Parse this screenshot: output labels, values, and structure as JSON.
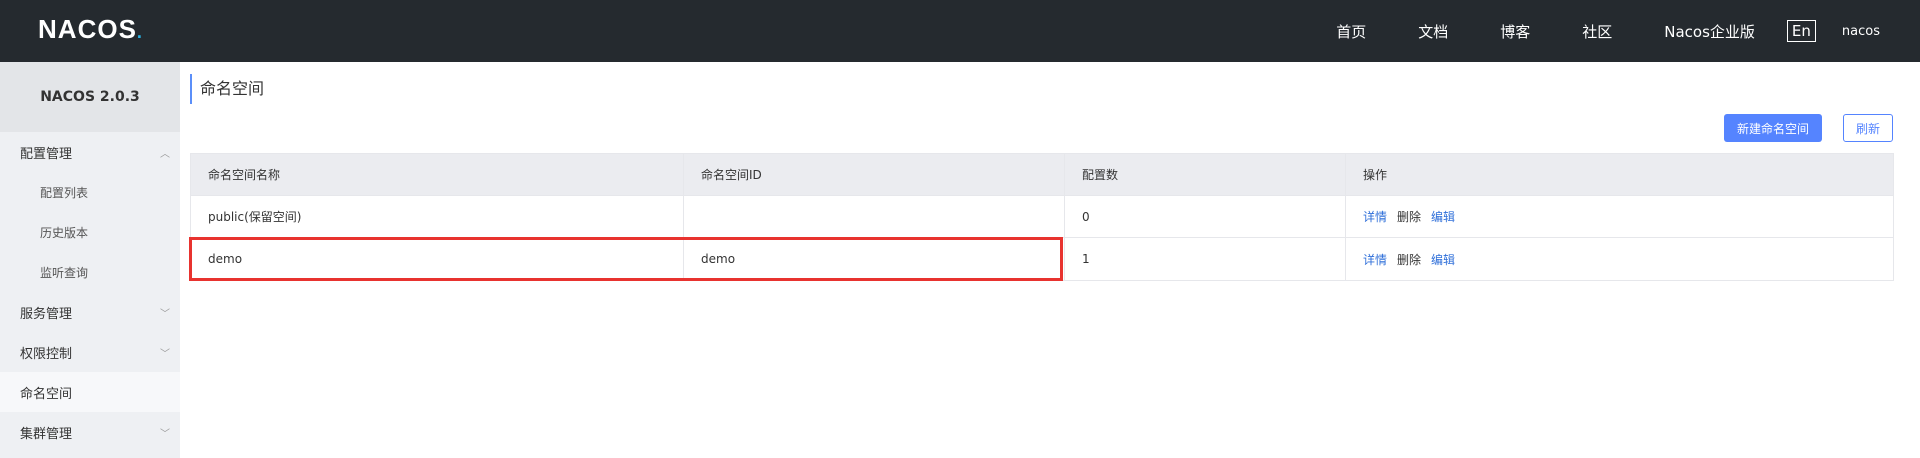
{
  "header": {
    "logo_text_1": "NA",
    "logo_text_2": "COS",
    "logo_dot": ".",
    "nav": [
      {
        "label": "首页"
      },
      {
        "label": "文档"
      },
      {
        "label": "博客"
      },
      {
        "label": "社区"
      },
      {
        "label": "Nacos企业版"
      }
    ],
    "lang_label": "En",
    "user_label": "nacos"
  },
  "sidebar": {
    "version": "NACOS 2.0.3",
    "groups": [
      {
        "label": "配置管理",
        "expanded": true,
        "items": [
          "配置列表",
          "历史版本",
          "监听查询"
        ]
      },
      {
        "label": "服务管理",
        "expanded": false
      },
      {
        "label": "权限控制",
        "expanded": false
      },
      {
        "label": "命名空间",
        "active": true
      },
      {
        "label": "集群管理",
        "expanded": false
      }
    ]
  },
  "main": {
    "title": "命名空间",
    "buttons": {
      "create": "新建命名空间",
      "refresh": "刷新"
    },
    "table": {
      "headers": [
        "命名空间名称",
        "命名空间ID",
        "配置数",
        "操作"
      ],
      "rows": [
        {
          "name": "public(保留空间)",
          "id": "",
          "count": "0",
          "actions": [
            "详情",
            "删除",
            "编辑"
          ]
        },
        {
          "name": "demo",
          "id": "demo",
          "count": "1",
          "actions": [
            "详情",
            "删除",
            "编辑"
          ]
        }
      ]
    }
  },
  "colors": {
    "header_bg": "#252a2f",
    "primary": "#5584ff",
    "link": "#2f6fd9",
    "highlight_box": "#e8332f"
  }
}
